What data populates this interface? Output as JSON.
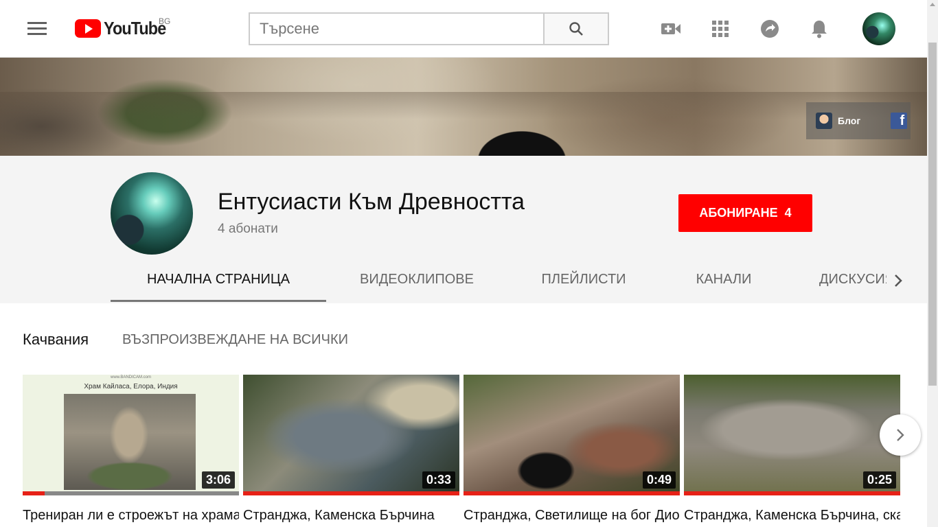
{
  "header": {
    "logo_text": "YouTube",
    "country": "BG",
    "search_placeholder": "Търсене",
    "icons": [
      "menu-icon",
      "search-icon",
      "video-camera-add-icon",
      "apps-grid-icon",
      "share-messages-icon",
      "notifications-bell-icon"
    ]
  },
  "banner": {
    "links": [
      {
        "label": "Блог",
        "icon": "blog-icon"
      },
      {
        "label": "",
        "icon": "facebook-icon"
      }
    ]
  },
  "channel": {
    "name": "Ентусиасти Към Древността",
    "subscribers": "4 абонати",
    "subscribe_label": "АБОНИРАНЕ",
    "subscribe_count": "4",
    "subscribe_color": "#ff0000"
  },
  "tabs": [
    {
      "label": "НАЧАЛНА СТРАНИЦА",
      "active": true
    },
    {
      "label": "ВИДЕОКЛИПОВЕ",
      "active": false
    },
    {
      "label": "ПЛЕЙЛИСТИ",
      "active": false
    },
    {
      "label": "КАНАЛИ",
      "active": false
    },
    {
      "label": "ДИСКУСИЯ",
      "active": false
    }
  ],
  "uploads": {
    "title": "Качвания",
    "play_all": "ВЪЗПРОИЗВЕЖДАНЕ НА ВСИЧКИ",
    "videos": [
      {
        "thumb_heading": "Храм Кайласа, Елора, Индия",
        "thumb_watermark": "www.BANDICAM.com",
        "duration": "3:06",
        "watched_fraction": 0.1,
        "title": "Трениран ли е строежът на храма Кайласа в Елора?"
      },
      {
        "duration": "0:33",
        "watched_fraction": 1.0,
        "title": "Странджа, Каменска Бърчина"
      },
      {
        "duration": "0:49",
        "watched_fraction": 1.0,
        "title": "Странджа, Светилище на бог Дионис"
      },
      {
        "duration": "0:25",
        "watched_fraction": 1.0,
        "title": "Странджа, Каменска Бърчина, скален олтар"
      }
    ]
  },
  "colors": {
    "accent": "#ff0000",
    "progress": "#e62117"
  }
}
